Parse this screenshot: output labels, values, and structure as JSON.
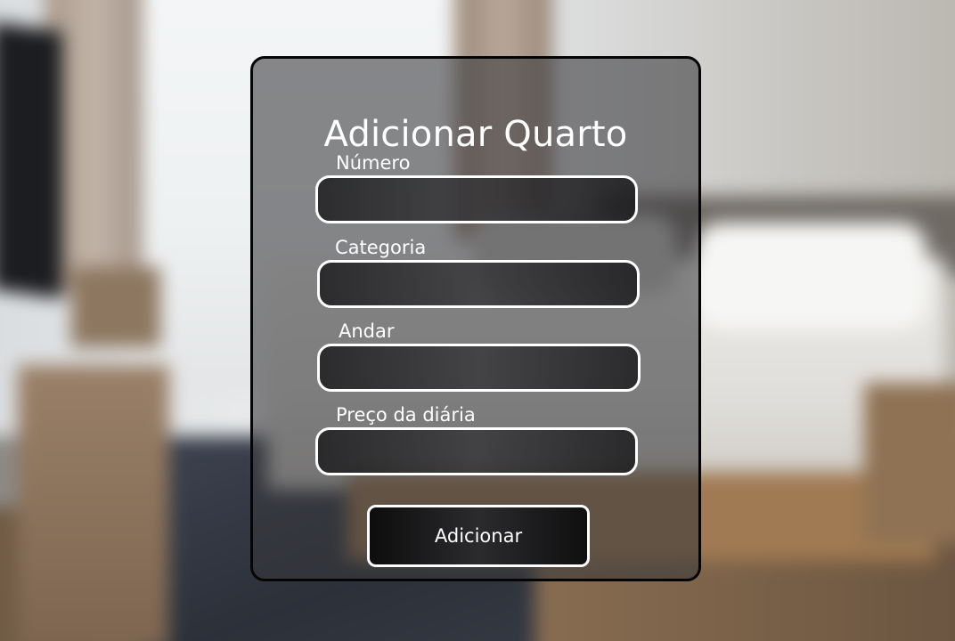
{
  "form": {
    "title": "Adicionar Quarto",
    "fields": [
      {
        "label": "Número",
        "value": "",
        "placeholder": ""
      },
      {
        "label": "Categoria",
        "value": "",
        "placeholder": ""
      },
      {
        "label": "Andar",
        "value": "",
        "placeholder": ""
      },
      {
        "label": "Preço da diária",
        "value": "",
        "placeholder": ""
      }
    ],
    "submit_label": "Adicionar"
  },
  "colors": {
    "card_border": "#050505",
    "input_border": "#ffffff",
    "text": "#ffffff"
  }
}
